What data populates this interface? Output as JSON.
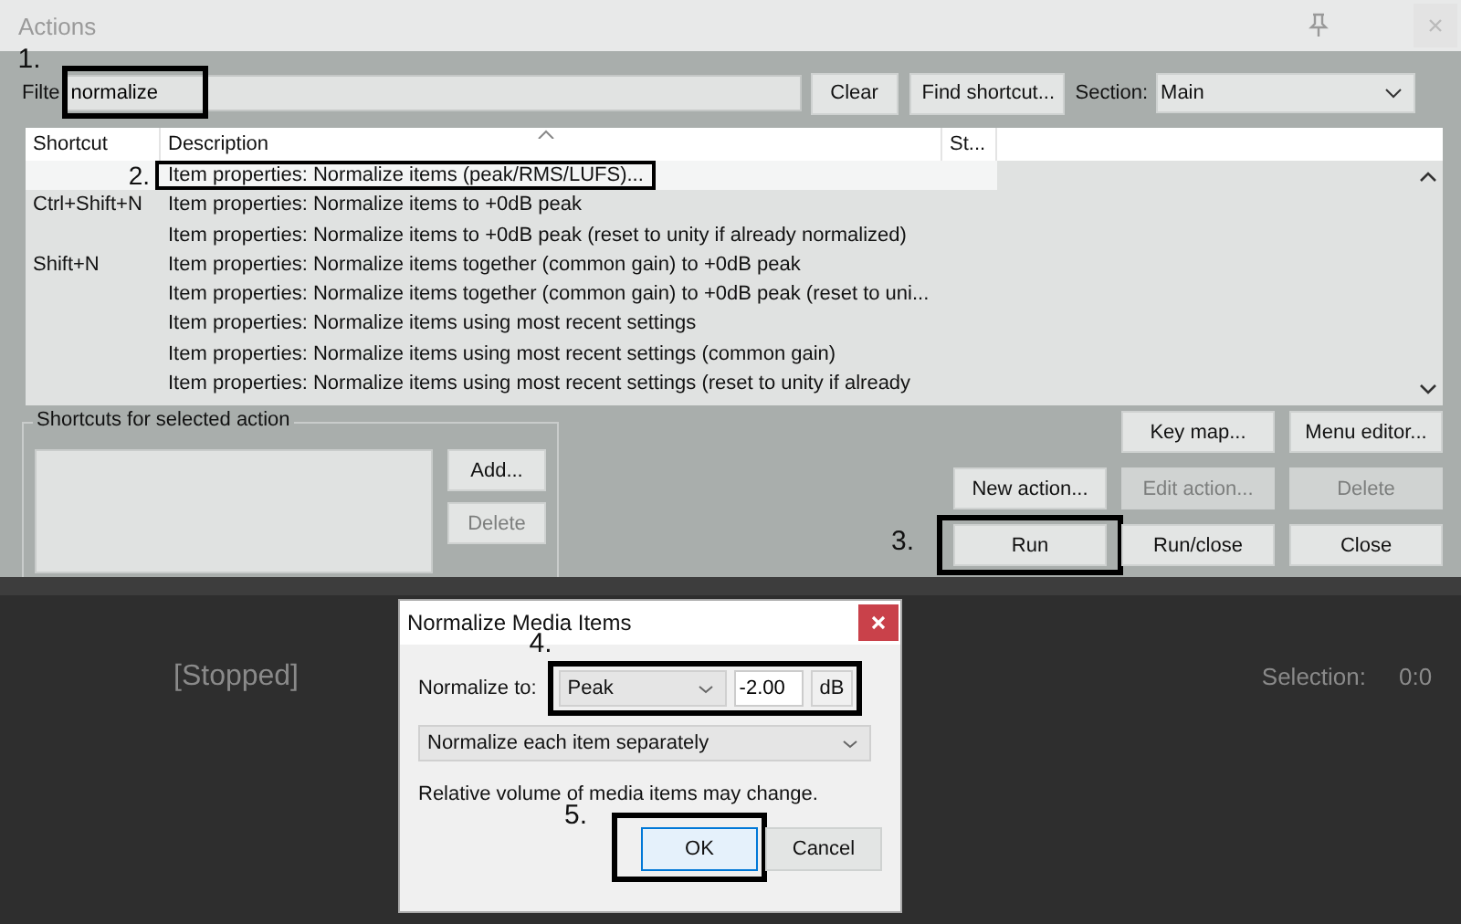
{
  "window": {
    "title": "Actions"
  },
  "filter": {
    "label": "Filte",
    "value": "normalize",
    "annotation": "1."
  },
  "top_buttons": [
    "Clear",
    "Find shortcut..."
  ],
  "section": {
    "label": "Section:",
    "value": "Main"
  },
  "table": {
    "columns": [
      "Shortcut",
      "Description",
      "St..."
    ],
    "rows": [
      {
        "shortcut": "",
        "description": "Item properties: Normalize items (peak/RMS/LUFS)...",
        "selected": true,
        "annotation": "2."
      },
      {
        "shortcut": "Ctrl+Shift+N",
        "description": "Item properties: Normalize items to +0dB peak",
        "selected": false
      },
      {
        "shortcut": "",
        "description": "Item properties: Normalize items to +0dB peak (reset to unity if already normalized)",
        "selected": false
      },
      {
        "shortcut": "Shift+N",
        "description": "Item properties: Normalize items together (common gain) to +0dB peak",
        "selected": false
      },
      {
        "shortcut": "",
        "description": "Item properties: Normalize items together (common gain) to +0dB peak (reset to uni...",
        "selected": false
      },
      {
        "shortcut": "",
        "description": "Item properties: Normalize items using most recent settings",
        "selected": false
      },
      {
        "shortcut": "",
        "description": "Item properties: Normalize items using most recent settings (common gain)",
        "selected": false
      },
      {
        "shortcut": "",
        "description": "Item properties: Normalize items using most recent settings (reset to unity if already",
        "selected": false
      }
    ]
  },
  "shortcuts_panel": {
    "title": "Shortcuts for selected action",
    "buttons": [
      {
        "label": "Add...",
        "disabled": false
      },
      {
        "label": "Delete",
        "disabled": true
      }
    ]
  },
  "action_buttons": [
    [
      {
        "label": "Key map...",
        "disabled": false
      },
      {
        "label": "Menu editor...",
        "disabled": false
      }
    ],
    [
      {
        "label": "New action...",
        "disabled": false
      },
      {
        "label": "Edit action...",
        "disabled": true
      },
      {
        "label": "Delete",
        "disabled": true
      }
    ],
    [
      {
        "label": "Run",
        "disabled": false,
        "annotation": "3."
      },
      {
        "label": "Run/close",
        "disabled": false
      },
      {
        "label": "Close",
        "disabled": false
      }
    ]
  ],
  "transport": {
    "status": "[Stopped]",
    "selection_label": "Selection:",
    "selection_value": "0:0"
  },
  "dialog": {
    "title": "Normalize Media Items",
    "normalize_label": "Normalize to:",
    "mode": "Peak",
    "value": "-2.00",
    "unit": "dB",
    "annotation": "4.",
    "scope": "Normalize each item separately",
    "note": "Relative volume of media items may change.",
    "buttons": [
      {
        "label": "OK",
        "default": true,
        "annotation": "5."
      },
      {
        "label": "Cancel",
        "default": false
      }
    ]
  }
}
